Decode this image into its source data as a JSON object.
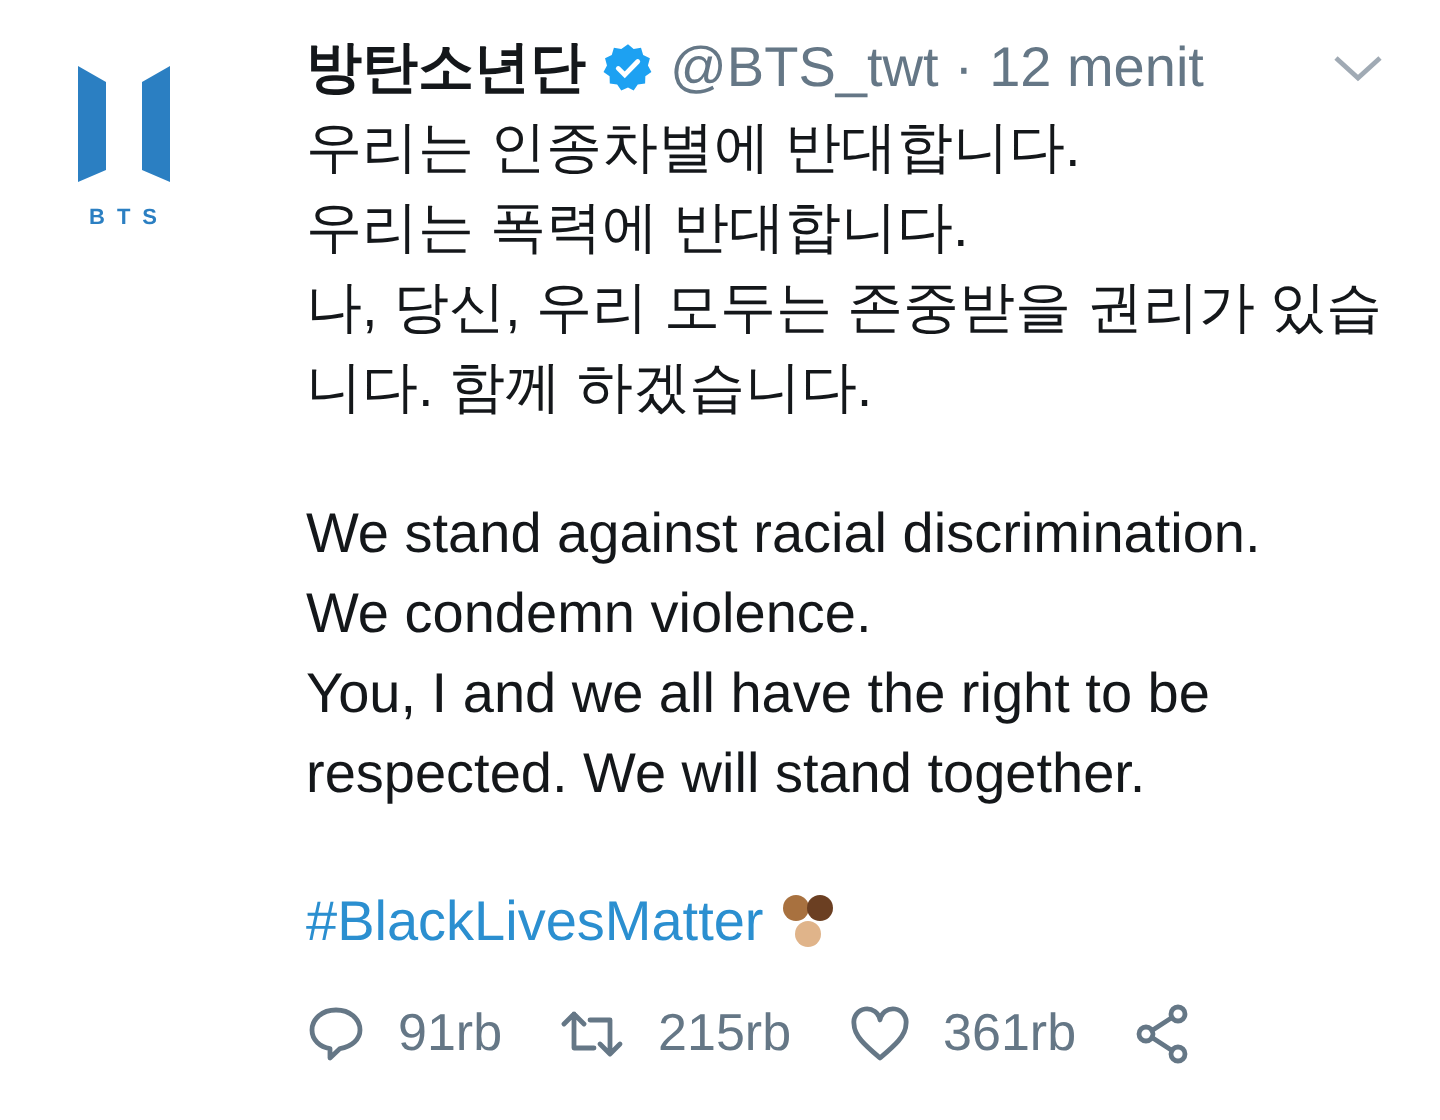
{
  "avatar": {
    "logo_text": "BTS"
  },
  "author": {
    "name": "방탄소년단",
    "verified": true,
    "handle": "@BTS_twt",
    "separator": "·",
    "time": "12 menit"
  },
  "paragraphs": [
    [
      "우리는 인종차별에 반대합니다.",
      "우리는 폭력에 반대합니다.",
      "나, 당신, 우리 모두는 존중받을 권리가 있습",
      "니다. 함께 하겠습니다."
    ],
    [
      "We stand against racial discrimination.",
      "We condemn violence.",
      "You, I and we all have the right to be",
      "respected. We will stand together."
    ]
  ],
  "hashtag": "#BlackLivesMatter",
  "actions": [
    {
      "kind": "reply",
      "count": "91rb"
    },
    {
      "kind": "retweet",
      "count": "215rb"
    },
    {
      "kind": "like",
      "count": "361rb"
    },
    {
      "kind": "share"
    }
  ]
}
